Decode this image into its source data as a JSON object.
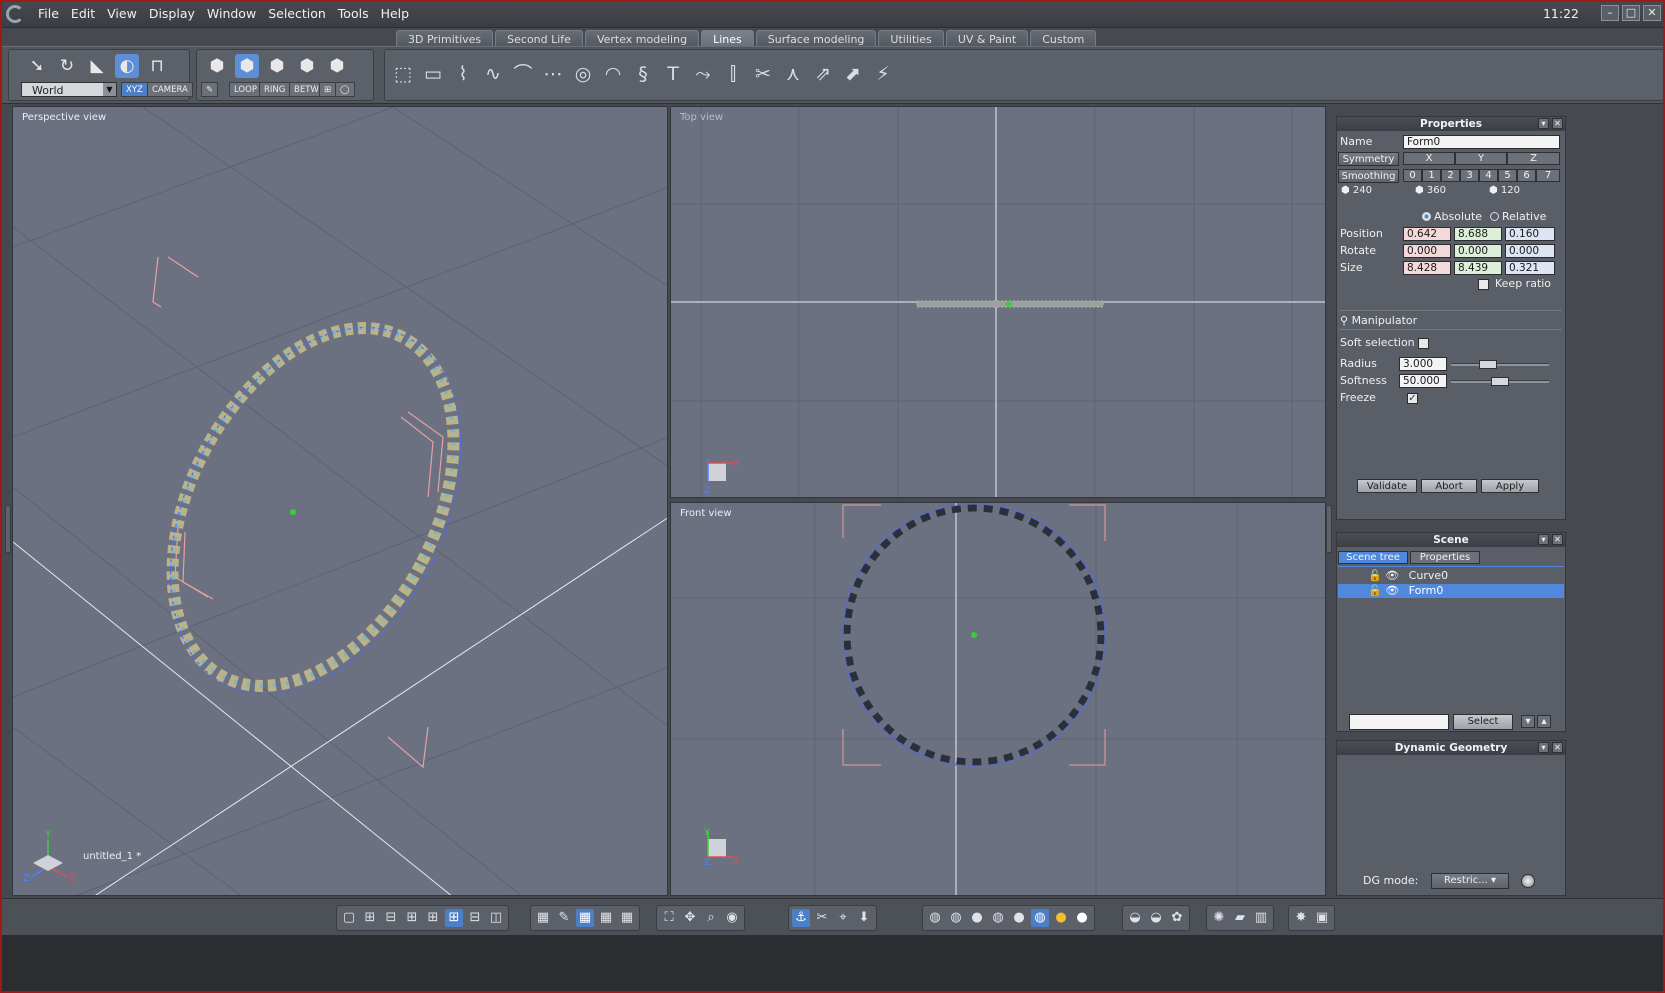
{
  "menu": [
    "File",
    "Edit",
    "View",
    "Display",
    "Window",
    "Selection",
    "Tools",
    "Help"
  ],
  "clock": "11:22",
  "window_buttons": [
    "minimize-icon",
    "maximize-icon",
    "close-icon"
  ],
  "tabs": [
    "3D Primitives",
    "Second Life",
    "Vertex modeling",
    "Lines",
    "Surface modeling",
    "Utilities",
    "UV & Paint",
    "Custom"
  ],
  "active_tab": "Lines",
  "toolbar": {
    "space_select": "World",
    "xyz_label": "XYZ",
    "camera_label": "CAMERA",
    "loop_label": "LOOP",
    "ring_label": "RING",
    "betw_label": "BETW"
  },
  "viewports": {
    "perspective": "Perspective view",
    "top": "Top view",
    "front": "Front view",
    "document": "untitled_1 *"
  },
  "properties": {
    "title": "Properties",
    "name_label": "Name",
    "name_value": "Form0",
    "symmetry_label": "Symmetry",
    "axes": [
      "X",
      "Y",
      "Z"
    ],
    "smoothing_label": "Smoothing",
    "smoothing_levels": [
      "0",
      "1",
      "2",
      "3",
      "4",
      "5",
      "6",
      "7"
    ],
    "counts": [
      "240",
      "360",
      "120"
    ],
    "absolute_label": "Absolute",
    "relative_label": "Relative",
    "mode": "Absolute",
    "position_label": "Position",
    "position": [
      "0.642",
      "8.688",
      "0.160"
    ],
    "rotate_label": "Rotate",
    "rotate": [
      "0.000",
      "0.000",
      "0.000"
    ],
    "size_label": "Size",
    "size": [
      "8.428",
      "8.439",
      "0.321"
    ],
    "keep_ratio_label": "Keep ratio",
    "keep_ratio": false,
    "manipulator_label": "Manipulator",
    "soft_selection_label": "Soft selection",
    "soft_selection": false,
    "radius_label": "Radius",
    "radius_value": "3.000",
    "radius_level": 0.35,
    "softness_label": "Softness",
    "softness_value": "50.000",
    "softness_level": 0.5,
    "freeze_label": "Freeze",
    "freeze": true,
    "validate": "Validate",
    "abort": "Abort",
    "apply": "Apply"
  },
  "scene": {
    "title": "Scene",
    "tabs": [
      "Scene tree",
      "Properties"
    ],
    "items": [
      "Curve0",
      "Form0"
    ],
    "selected": "Form0",
    "select_button": "Select"
  },
  "dynamic_geometry": {
    "title": "Dynamic Geometry",
    "dg_mode_label": "DG mode:",
    "dg_mode_value": "Restric..."
  },
  "colors": {
    "viewport_bg": "#6b7181",
    "selection_blue": "#4f88dc",
    "curve_dash": "#3a5fe8",
    "frame_red": "#a01818"
  }
}
